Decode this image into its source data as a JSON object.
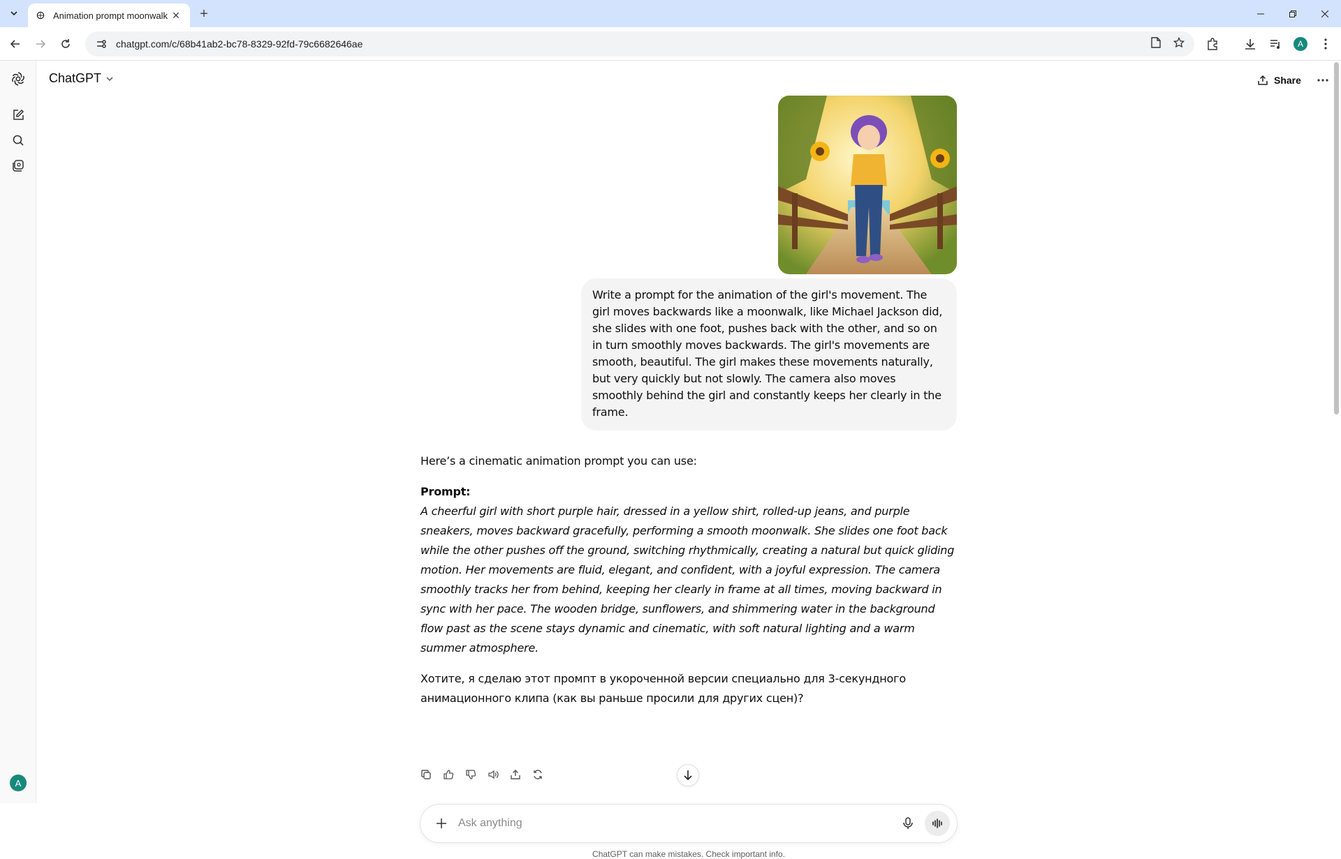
{
  "browser": {
    "tab_title": "Animation prompt moonwalk",
    "url": "chatgpt.com/c/68b41ab2-bc78-8329-92fd-79c6682646ae",
    "profile_initial": "A"
  },
  "header": {
    "model_name": "ChatGPT",
    "share_label": "Share"
  },
  "sidebar": {
    "avatar_initial": "A"
  },
  "conversation": {
    "user_message": "Write a prompt for the animation of the girl's movement. The girl moves backwards like a moonwalk, like Michael Jackson did, she slides with one foot, pushes back with the other, and so on in turn smoothly moves backwards. The girl's movements are smooth, beautiful. The girl makes these movements naturally, but very quickly but not slowly. The camera also moves smoothly behind the girl and constantly keeps her clearly in the frame.",
    "assistant_intro": "Here’s a cinematic animation prompt you can use:",
    "prompt_heading": "Prompt:",
    "prompt_body": "A cheerful girl with short purple hair, dressed in a yellow shirt, rolled-up jeans, and purple sneakers, moves backward gracefully, performing a smooth moonwalk. She slides one foot back while the other pushes off the ground, switching rhythmically, creating a natural but quick gliding motion. Her movements are fluid, elegant, and confident, with a joyful expression. The camera smoothly tracks her from behind, keeping her clearly in frame at all times, moving backward in sync with her pace. The wooden bridge, sunflowers, and shimmering water in the background flow past as the scene stays dynamic and cinematic, with soft natural lighting and a warm summer atmosphere.",
    "assistant_followup": "Хотите, я сделаю этот промпт в укороченной версии специально для 3-секундного анимационного клипа (как вы раньше просили для других сцен)?"
  },
  "composer": {
    "placeholder": "Ask anything"
  },
  "footer": {
    "disclaimer": "ChatGPT can make mistakes. Check important info."
  },
  "colors": {
    "tabstrip": "#d3e3fd",
    "user_bubble": "#f4f4f4",
    "avatar": "#16897c"
  }
}
